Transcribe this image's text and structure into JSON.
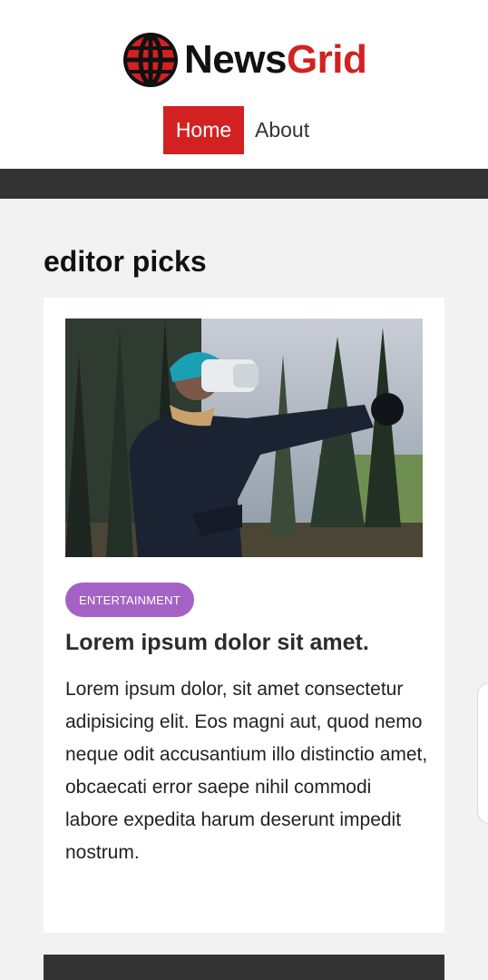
{
  "brand": {
    "name_part1": "News",
    "name_part2": "Grid",
    "logo_icon": "globe-icon",
    "accent_color": "#d32121"
  },
  "nav": {
    "items": [
      {
        "label": "Home",
        "active": true
      },
      {
        "label": "About",
        "active": false
      }
    ]
  },
  "section": {
    "title": "editor picks"
  },
  "card": {
    "image_icon": "article-photo",
    "category": "ENTERTAINMENT",
    "category_color": "#a463c4",
    "title": "Lorem ipsum dolor sit amet.",
    "body": "Lorem ipsum dolor, sit amet consectetur adipisicing elit. Eos magni aut, quod nemo neque odit accusantium illo distinctio amet, obcaecati error saepe nihil commodi labore expedita harum deserunt impedit nostrum."
  }
}
